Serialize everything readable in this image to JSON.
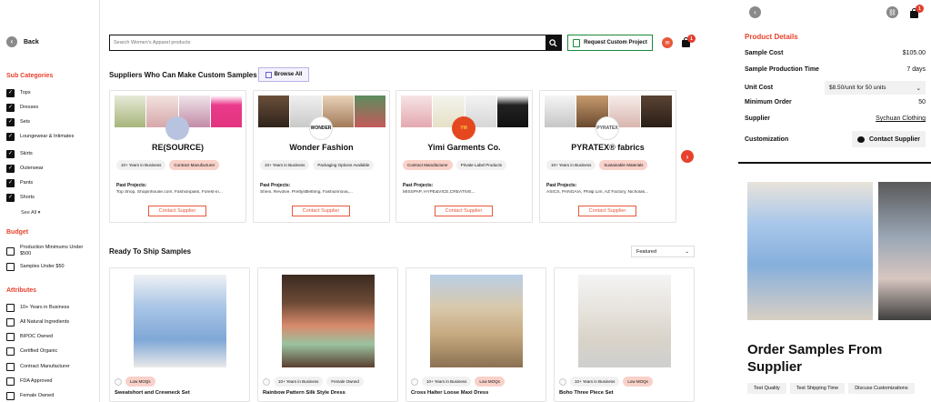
{
  "nav": {
    "back_label": "Back"
  },
  "filters": {
    "sub_categories_title": "Sub Categories",
    "sub_categories": [
      {
        "label": "Tops",
        "checked": true
      },
      {
        "label": "Dresses",
        "checked": true
      },
      {
        "label": "Sets",
        "checked": true
      },
      {
        "label": "Loungewear & Intimates",
        "checked": true
      },
      {
        "label": "Skirts",
        "checked": true
      },
      {
        "label": "Outerwear",
        "checked": true
      },
      {
        "label": "Pants",
        "checked": true
      },
      {
        "label": "Shorts",
        "checked": true
      }
    ],
    "see_all": "See All",
    "budget_title": "Budget",
    "budget": [
      {
        "label": "Production Minimums Under $500",
        "checked": false
      },
      {
        "label": "Samples Under $50",
        "checked": false
      }
    ],
    "attributes_title": "Attributes",
    "attributes": [
      {
        "label": "10+ Years in Business",
        "checked": false
      },
      {
        "label": "All Natural Ingredients",
        "checked": false
      },
      {
        "label": "BIPOC Owned",
        "checked": false
      },
      {
        "label": "Certified Organic",
        "checked": false
      },
      {
        "label": "Contract Manufacturer",
        "checked": false
      },
      {
        "label": "FDA Approved",
        "checked": false
      },
      {
        "label": "Female Owned",
        "checked": false
      }
    ]
  },
  "search": {
    "placeholder": "Search Women's Apparel products"
  },
  "header": {
    "request_label": "Request Custom Project",
    "cart_count": "1"
  },
  "suppliers_section": {
    "title": "Suppliers Who Can Make Custom Samples",
    "browse_label": "Browse All",
    "cards": [
      {
        "name": "RE(SOURCE)",
        "logo": "",
        "tags": [
          "10+ Years in Business",
          "Contract Manufacturer"
        ],
        "past_projects_label": "Past Projects:",
        "past_projects": "Top Shop, Shopinhouse.com, Fashionpass, Forest-in...",
        "contact_label": "Contact Supplier"
      },
      {
        "name": "Wonder Fashion",
        "logo": "WONDER",
        "tags": [
          "10+ Years in Business",
          "Packaging Options Available"
        ],
        "past_projects_label": "Past Projects:",
        "past_projects": "Shein, Revolve, Prettylittlething, Fashionnova,...",
        "contact_label": "Contact Supplier"
      },
      {
        "name": "Yimi Garments Co.",
        "logo": "YM",
        "tags": [
          "Contract Manufacturer",
          "Private Label Products"
        ],
        "past_projects_label": "Past Projects:",
        "past_projects": "MISSPAP, HYPE&VICE,CREATIVE...",
        "contact_label": "Contact Supplier"
      },
      {
        "name": "PYRATEX® fabrics",
        "logo": "PYRATEX",
        "tags": [
          "10+ Years in Business",
          "Sustainable Materials"
        ],
        "past_projects_label": "Past Projects:",
        "past_projects": "ASICS, PANGAIA, Philip Lim, AZ Factory, Nicholas...",
        "contact_label": "Contact Supplier"
      }
    ]
  },
  "ready_section": {
    "title": "Ready To Ship Samples",
    "sort_value": "Featured",
    "products": [
      {
        "name": "Sweatshort and Crewneck Set",
        "tags": [
          "Low MOQs"
        ]
      },
      {
        "name": "Rainbow Pattern Silk Style Dress",
        "tags": [
          "10+ Years in Business",
          "Female Owned"
        ]
      },
      {
        "name": "Cross Halter Loose Maxi Dress",
        "tags": [
          "10+ Years in Business",
          "Low MOQs"
        ]
      },
      {
        "name": "Boho Three Piece Set",
        "tags": [
          "10+ Years in Business",
          "Low MOQs"
        ]
      }
    ]
  },
  "panel": {
    "cart_count": "1",
    "title": "Product Details",
    "sample_cost_label": "Sample Cost",
    "sample_cost": "$105.00",
    "production_time_label": "Sample Production Time",
    "production_time": "7 days",
    "unit_cost_label": "Unit Cost",
    "unit_cost": "$8.50/unit for 50 units",
    "min_order_label": "Minimum Order",
    "min_order": "50",
    "supplier_label": "Supplier",
    "supplier": "Sychuan Clothing",
    "customization_label": "Customization",
    "contact_label": "Contact Supplier",
    "heading": "Order Samples From Supplier",
    "tags": [
      "Test Quality",
      "Test Shipping Time",
      "Discuss Customizations"
    ]
  },
  "colors": {
    "accent": "#e8412c",
    "pink_tag": "#f8d1c9",
    "green": "#1b8a3a"
  }
}
